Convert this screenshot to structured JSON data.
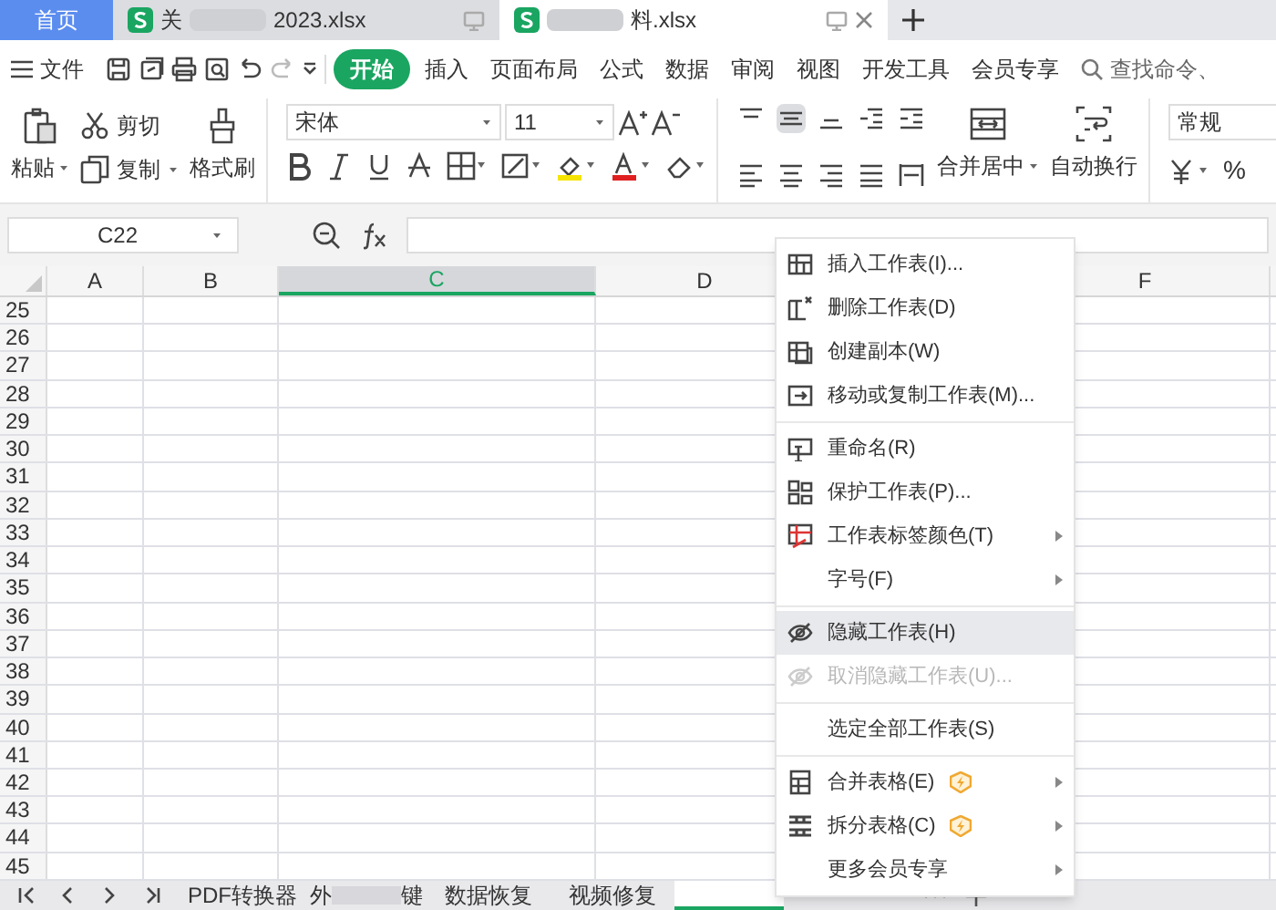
{
  "doc_tabs": [
    {
      "kind": "home",
      "label": "首页",
      "selected": false
    },
    {
      "kind": "file",
      "label_start": "关",
      "label_end": "2023.xlsx",
      "selected": false
    },
    {
      "kind": "file",
      "label_end": "料.xlsx",
      "selected": true
    }
  ],
  "file_menu": "文件",
  "ribbon_tabs": [
    {
      "label": "开始",
      "selected": true
    },
    {
      "label": "插入",
      "selected": false
    },
    {
      "label": "页面布局",
      "selected": false
    },
    {
      "label": "公式",
      "selected": false
    },
    {
      "label": "数据",
      "selected": false
    },
    {
      "label": "审阅",
      "selected": false
    },
    {
      "label": "视图",
      "selected": false
    },
    {
      "label": "开发工具",
      "selected": false
    },
    {
      "label": "会员专享",
      "selected": false
    }
  ],
  "search": {
    "placeholder": "查找命令、"
  },
  "ribbon": {
    "paste": "粘贴",
    "cut": "剪切",
    "copy": "复制",
    "format_painter": "格式刷",
    "font": "宋体",
    "font_size": "11",
    "merge": "合并居中",
    "wrap": "自动换行",
    "number_format": "常规",
    "percent": "%"
  },
  "name_box": "C22",
  "columns": [
    {
      "label": "A",
      "selected": false
    },
    {
      "label": "B",
      "selected": false
    },
    {
      "label": "C",
      "selected": true
    },
    {
      "label": "D",
      "selected": false
    },
    {
      "label": "F",
      "selected": false
    }
  ],
  "rows": [
    "25",
    "26",
    "27",
    "28",
    "29",
    "30",
    "31",
    "32",
    "33",
    "34",
    "35",
    "36",
    "37",
    "38",
    "39",
    "40",
    "41",
    "42",
    "43",
    "44",
    "45"
  ],
  "sheet_tabs": [
    {
      "label_start": "PDF转换器",
      "selected": false
    },
    {
      "label_start": "外",
      "label_end": "键",
      "selected": false
    },
    {
      "label_start": "数据恢复",
      "selected": false
    },
    {
      "label_start": "视频修复",
      "selected": false
    },
    {
      "selected": true
    },
    {
      "selected": false
    }
  ],
  "context_menu": [
    {
      "kind": "item",
      "label": "插入工作表(I)...",
      "submenu": false,
      "disabled": false,
      "selected": false,
      "premium": false
    },
    {
      "kind": "item",
      "label": "删除工作表(D)",
      "submenu": false,
      "disabled": false,
      "selected": false,
      "premium": false
    },
    {
      "kind": "item",
      "label": "创建副本(W)",
      "submenu": false,
      "disabled": false,
      "selected": false,
      "premium": false
    },
    {
      "kind": "item",
      "label": "移动或复制工作表(M)...",
      "submenu": false,
      "disabled": false,
      "selected": false,
      "premium": false
    },
    {
      "kind": "separator"
    },
    {
      "kind": "item",
      "label": "重命名(R)",
      "submenu": false,
      "disabled": false,
      "selected": false,
      "premium": false
    },
    {
      "kind": "item",
      "label": "保护工作表(P)...",
      "submenu": false,
      "disabled": false,
      "selected": false,
      "premium": false
    },
    {
      "kind": "item",
      "label": "工作表标签颜色(T)",
      "submenu": true,
      "disabled": false,
      "selected": false,
      "premium": false
    },
    {
      "kind": "item",
      "label": "字号(F)",
      "submenu": true,
      "disabled": false,
      "selected": false,
      "premium": false
    },
    {
      "kind": "separator"
    },
    {
      "kind": "item",
      "label": "隐藏工作表(H)",
      "submenu": false,
      "disabled": false,
      "selected": true,
      "premium": false
    },
    {
      "kind": "item",
      "label": "取消隐藏工作表(U)...",
      "submenu": false,
      "disabled": true,
      "selected": false,
      "premium": false
    },
    {
      "kind": "separator"
    },
    {
      "kind": "item",
      "label": "选定全部工作表(S)",
      "submenu": false,
      "disabled": false,
      "selected": false,
      "premium": false
    },
    {
      "kind": "separator"
    },
    {
      "kind": "item",
      "label": "合并表格(E)",
      "submenu": true,
      "disabled": false,
      "selected": false,
      "premium": true
    },
    {
      "kind": "item",
      "label": "拆分表格(C)",
      "submenu": true,
      "disabled": false,
      "selected": false,
      "premium": true
    },
    {
      "kind": "item",
      "label": "更多会员专享",
      "submenu": true,
      "disabled": false,
      "selected": false,
      "premium": false
    }
  ]
}
